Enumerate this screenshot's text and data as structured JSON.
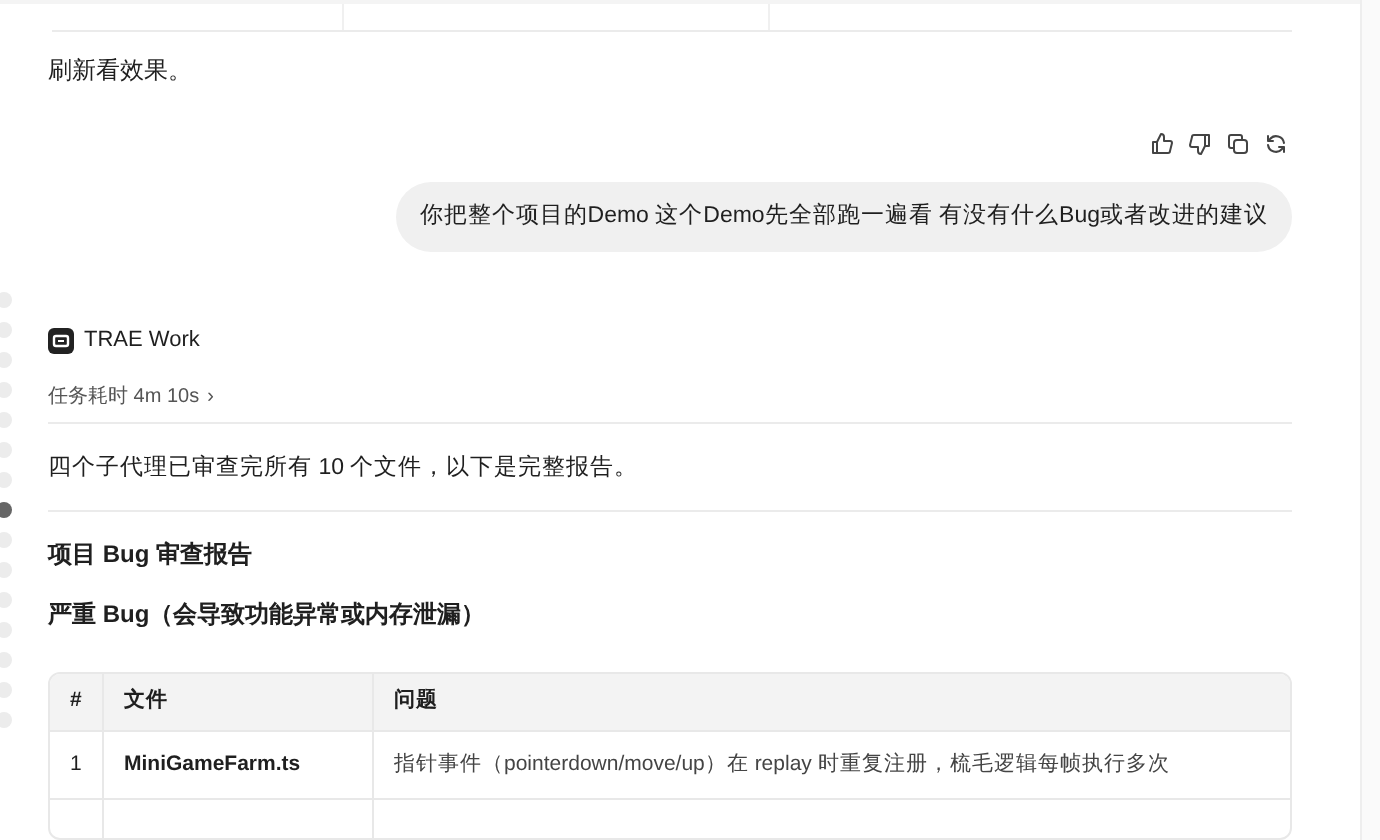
{
  "previous_answer": {
    "text": "刷新看效果。"
  },
  "feedback_actions": [
    {
      "kind": "like"
    },
    {
      "kind": "dislike"
    },
    {
      "kind": "copy"
    },
    {
      "kind": "retry"
    }
  ],
  "user_message": {
    "text": "你把整个项目的Demo 这个Demo先全部跑一遍看 有没有什么Bug或者改进的建议"
  },
  "timeline_dots": [
    {
      "selected": false
    },
    {
      "selected": false
    },
    {
      "selected": false
    },
    {
      "selected": false
    },
    {
      "selected": false
    },
    {
      "selected": false
    },
    {
      "selected": false
    },
    {
      "selected": true
    },
    {
      "selected": false
    },
    {
      "selected": false
    },
    {
      "selected": false
    },
    {
      "selected": false
    },
    {
      "selected": false
    },
    {
      "selected": false
    },
    {
      "selected": false
    }
  ],
  "agent": {
    "name": "TRAE Work",
    "duration": "任务耗时 4m 10s",
    "chevron": "›"
  },
  "summary": "四个子代理已审查完所有 10 个文件，以下是完整报告。",
  "report_title": "项目 Bug 审查报告",
  "section_title": "严重 Bug（会导致功能异常或内存泄漏）",
  "table": {
    "columns": [
      "#",
      "文件",
      "问题"
    ],
    "rows": [
      {
        "cells": [
          "1",
          "MiniGameFarm.ts",
          "指针事件（pointerdown/move/up）在 replay 时重复注册，梳毛逻辑每帧执行多次"
        ]
      }
    ]
  }
}
